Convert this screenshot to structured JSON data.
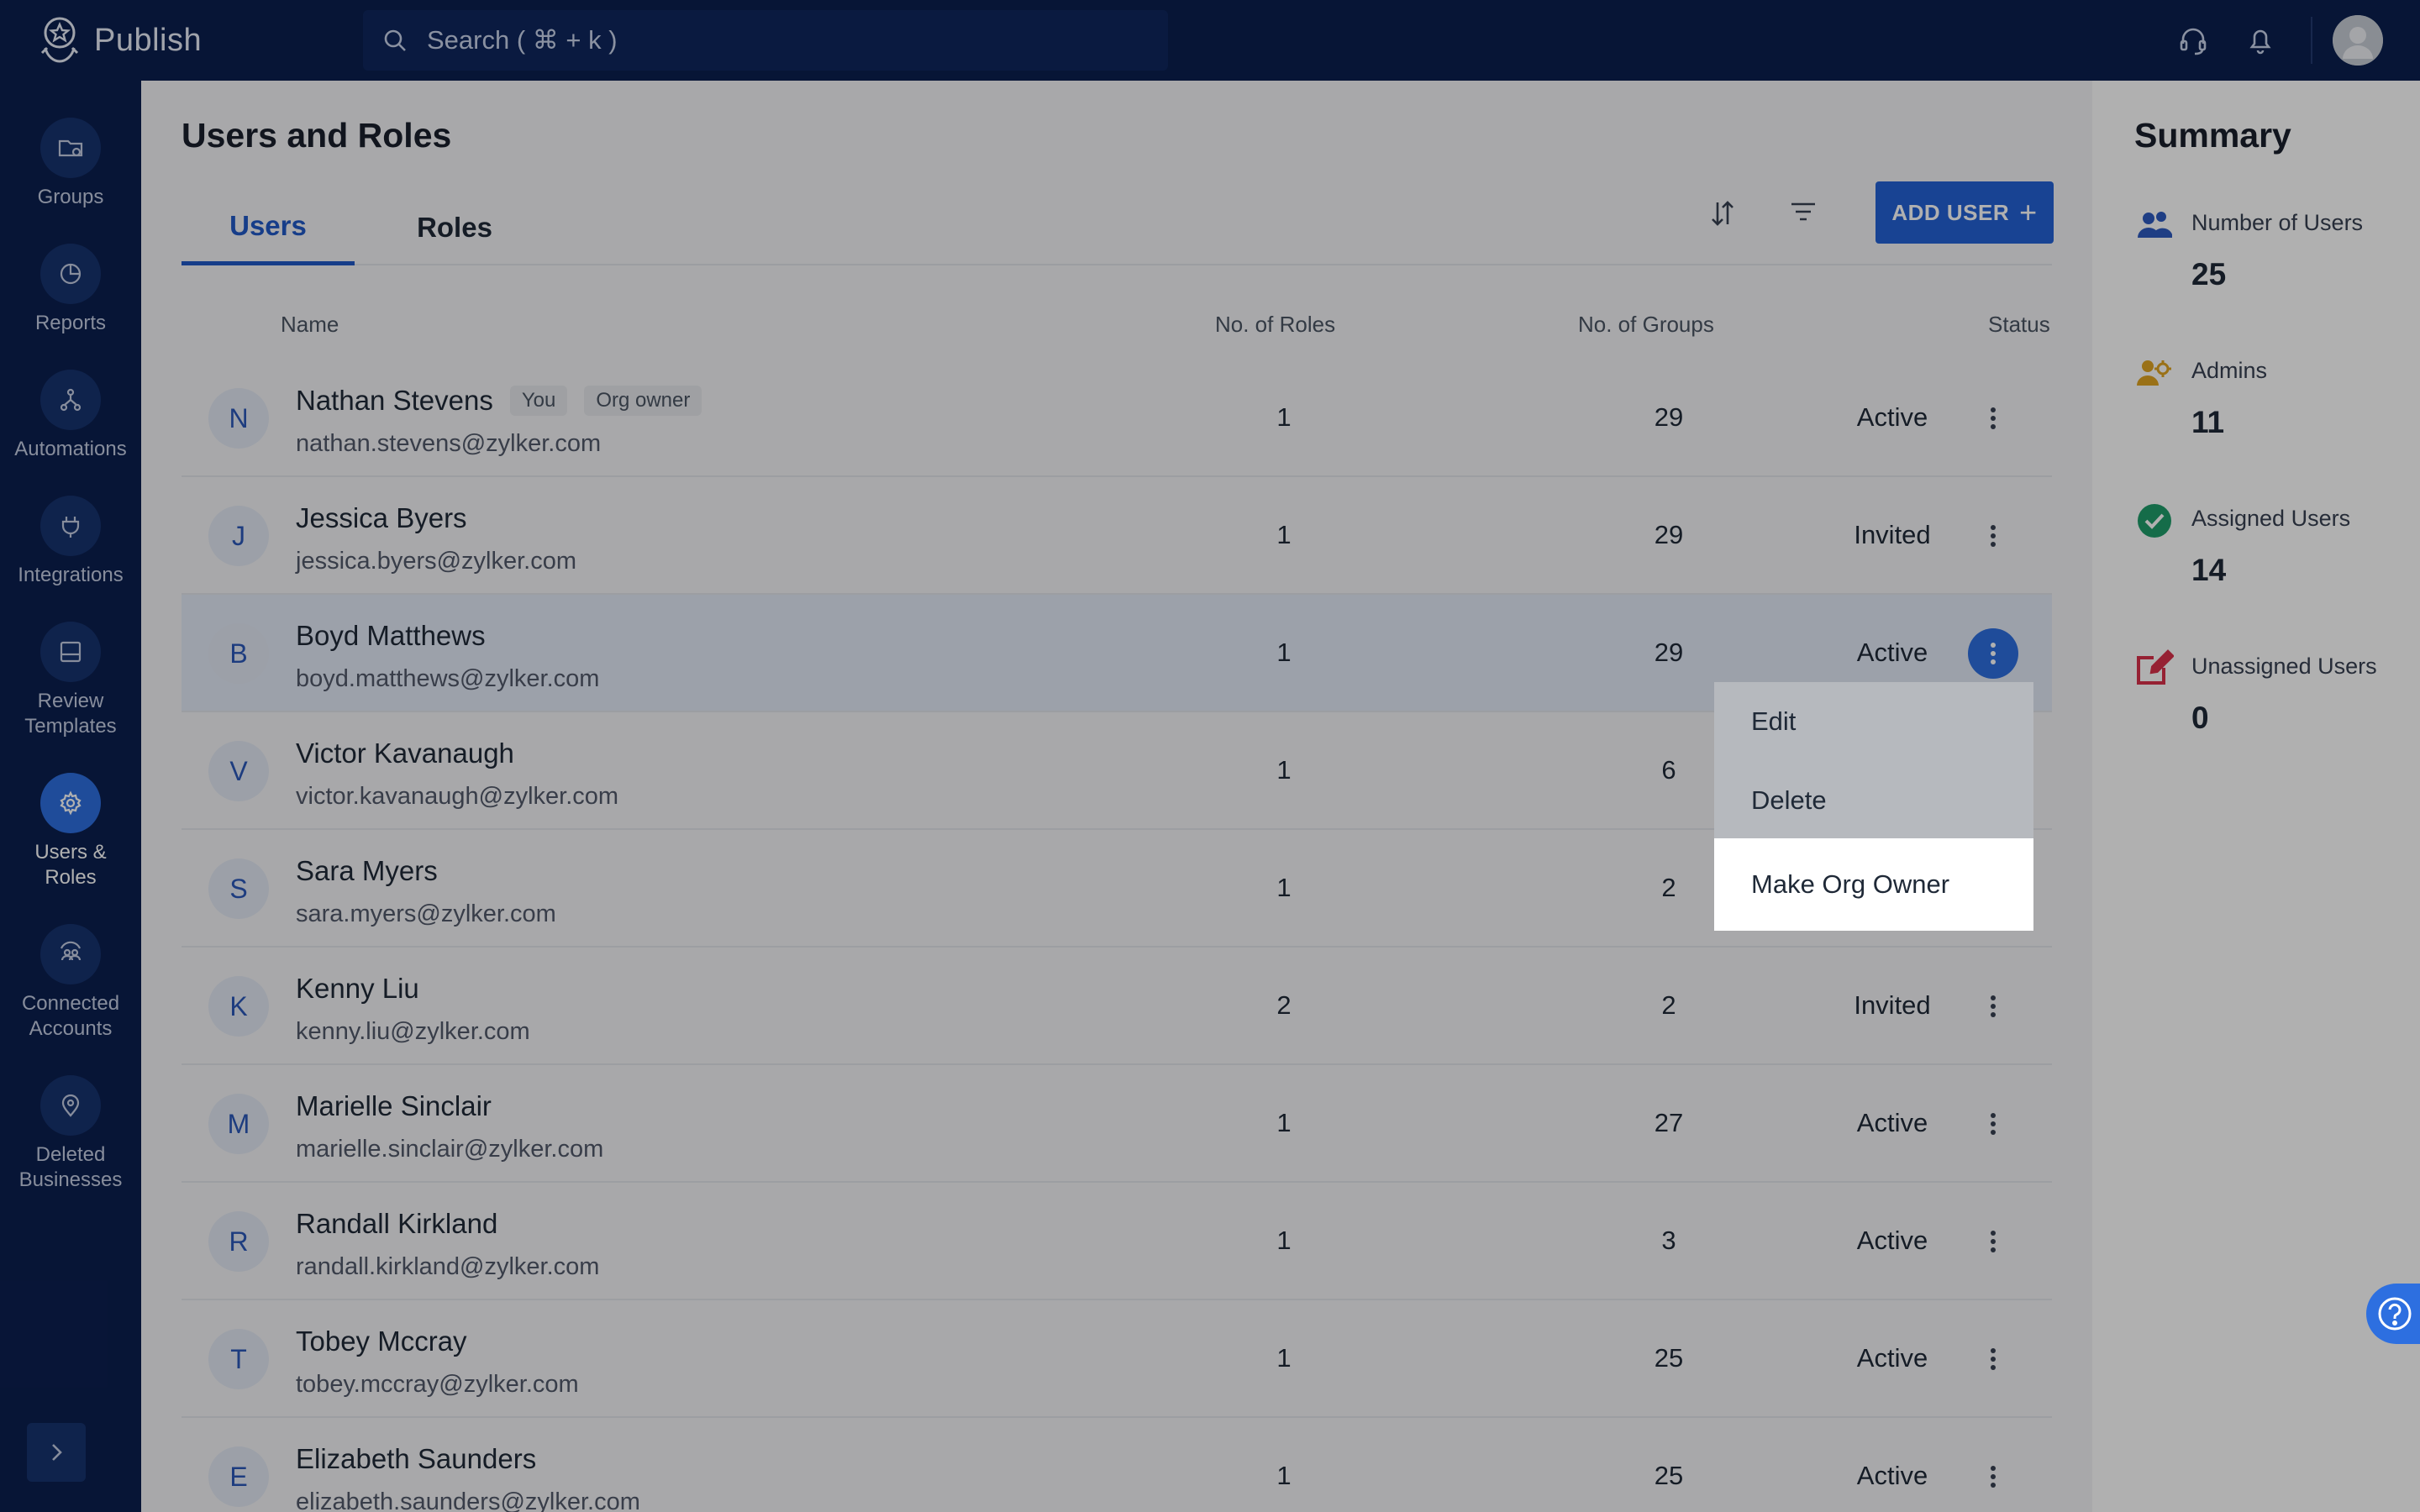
{
  "app": {
    "name": "Publish"
  },
  "search": {
    "placeholder": "Search ( ⌘ + k )"
  },
  "topbar_icons": [
    "headset-icon",
    "bell-icon",
    "user-avatar"
  ],
  "sidebar": {
    "items": [
      {
        "label": "Groups",
        "icon": "groups-icon"
      },
      {
        "label": "Reports",
        "icon": "pie-chart-icon"
      },
      {
        "label": "Automations",
        "icon": "automation-icon"
      },
      {
        "label": "Integrations",
        "icon": "plug-icon"
      },
      {
        "label": "Review\nTemplates",
        "icon": "template-icon"
      },
      {
        "label": "Users &\nRoles",
        "icon": "gear-icon",
        "active": true
      },
      {
        "label": "Connected\nAccounts",
        "icon": "connected-accounts-icon"
      },
      {
        "label": "Deleted\nBusinesses",
        "icon": "location-pin-icon"
      }
    ]
  },
  "page": {
    "title": "Users and Roles",
    "tabs": [
      {
        "label": "Users",
        "active": true
      },
      {
        "label": "Roles",
        "active": false
      }
    ],
    "add_user_label": "ADD USER",
    "columns": [
      "Name",
      "No. of Roles",
      "No. of Groups",
      "Status"
    ]
  },
  "users": [
    {
      "initial": "N",
      "name": "Nathan Stevens",
      "email": "nathan.stevens@zylker.com",
      "roles": "1",
      "groups": "29",
      "status": "Active",
      "badges": [
        "You",
        "Org owner"
      ]
    },
    {
      "initial": "J",
      "name": "Jessica Byers",
      "email": "jessica.byers@zylker.com",
      "roles": "1",
      "groups": "29",
      "status": "Invited"
    },
    {
      "initial": "B",
      "name": "Boyd Matthews",
      "email": "boyd.matthews@zylker.com",
      "roles": "1",
      "groups": "29",
      "status": "Active",
      "selected": true
    },
    {
      "initial": "V",
      "name": "Victor Kavanaugh",
      "email": "victor.kavanaugh@zylker.com",
      "roles": "1",
      "groups": "6",
      "status": ""
    },
    {
      "initial": "S",
      "name": "Sara Myers",
      "email": "sara.myers@zylker.com",
      "roles": "1",
      "groups": "2",
      "status": ""
    },
    {
      "initial": "K",
      "name": "Kenny Liu",
      "email": "kenny.liu@zylker.com",
      "roles": "2",
      "groups": "2",
      "status": "Invited"
    },
    {
      "initial": "M",
      "name": "Marielle Sinclair",
      "email": "marielle.sinclair@zylker.com",
      "roles": "1",
      "groups": "27",
      "status": "Active"
    },
    {
      "initial": "R",
      "name": "Randall Kirkland",
      "email": "randall.kirkland@zylker.com",
      "roles": "1",
      "groups": "3",
      "status": "Active"
    },
    {
      "initial": "T",
      "name": "Tobey Mccray",
      "email": "tobey.mccray@zylker.com",
      "roles": "1",
      "groups": "25",
      "status": "Active"
    },
    {
      "initial": "E",
      "name": "Elizabeth Saunders",
      "email": "elizabeth.saunders@zylker.com",
      "roles": "1",
      "groups": "25",
      "status": "Active"
    }
  ],
  "context_menu": {
    "items": [
      "Edit",
      "Delete",
      "Make Org Owner"
    ],
    "highlighted": "Make Org Owner"
  },
  "summary": {
    "title": "Summary",
    "items": [
      {
        "label": "Number of Users",
        "value": "25",
        "icon": "users-icon",
        "color": "#2d5bbf"
      },
      {
        "label": "Admins",
        "value": "11",
        "icon": "admin-icon",
        "color": "#e0a422"
      },
      {
        "label": "Assigned Users",
        "value": "14",
        "icon": "check-circle-icon",
        "color": "#1f9d6b"
      },
      {
        "label": "Unassigned Users",
        "value": "0",
        "icon": "edit-box-icon",
        "color": "#d9304a"
      }
    ]
  },
  "colors": {
    "nav_bg": "#0b1f4f",
    "accent": "#2361d6"
  }
}
